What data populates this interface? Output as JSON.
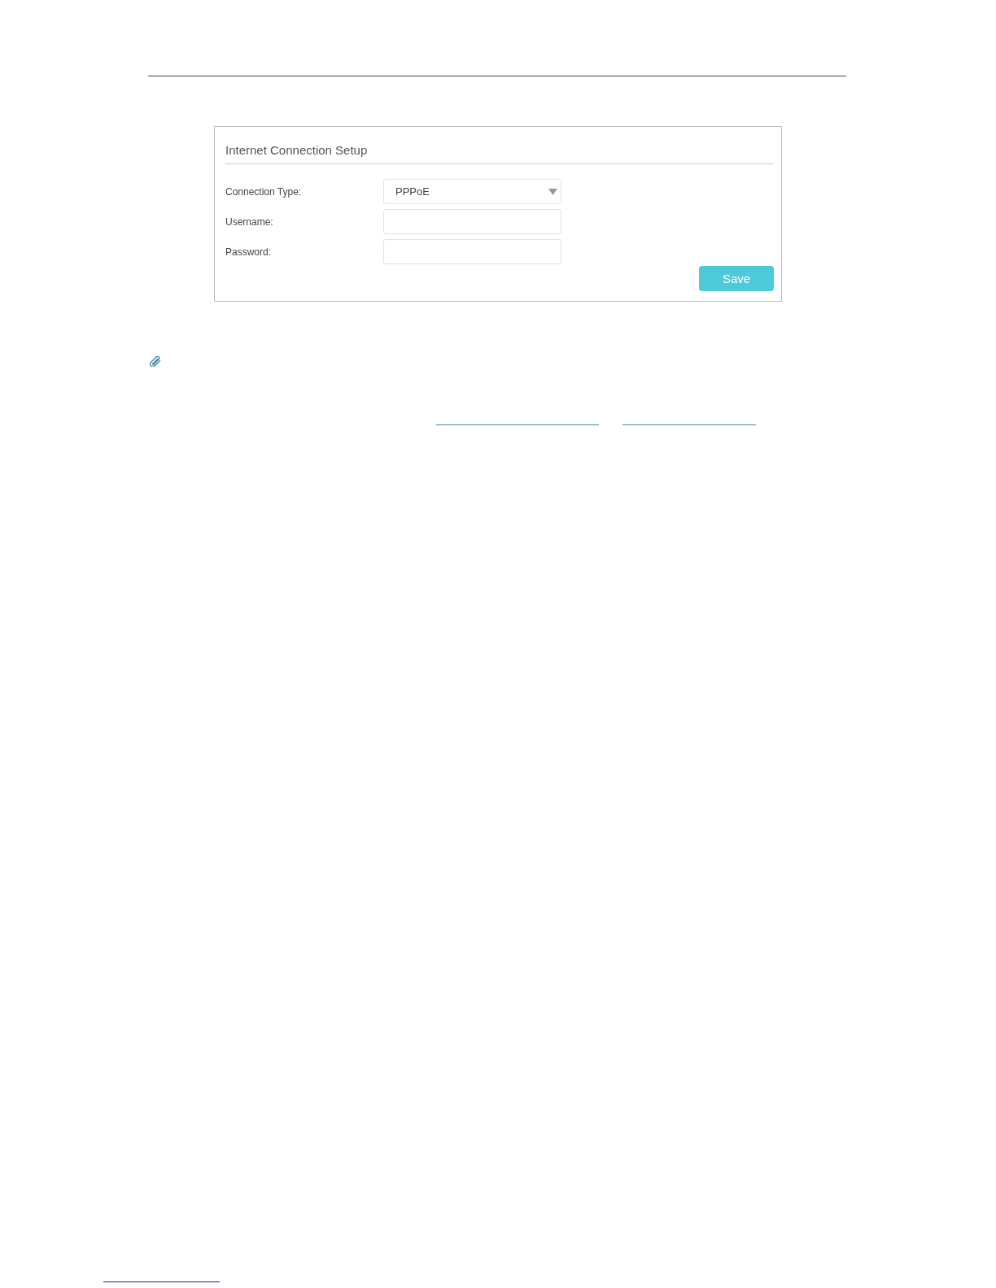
{
  "panel": {
    "title": "Internet Connection Setup",
    "fields": [
      {
        "kind": "select",
        "label": "Connection Type:",
        "value": "PPPoE"
      },
      {
        "kind": "text",
        "label": "Username:"
      },
      {
        "kind": "text",
        "label": "Password:"
      }
    ],
    "buttons": [
      "Save"
    ]
  }
}
